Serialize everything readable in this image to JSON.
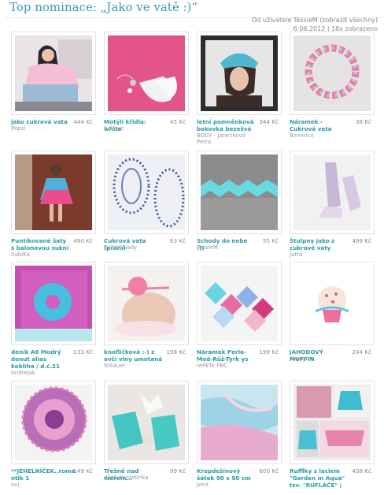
{
  "title": "Top nominace: „Jako ve vatě :)“",
  "meta": {
    "prefix": "Od uživatele",
    "user": "TessieM",
    "show_all": "(zobrazit všechny)",
    "date": "6.06.2012",
    "views": "18x zobrazeno"
  },
  "items": [
    {
      "name": "jako cukrová vata",
      "price": "444 Kč",
      "author": "Pepsi"
    },
    {
      "name": "Motýlí křídla: white",
      "price": "45 Kč",
      "author": "buttear"
    },
    {
      "name": "letní pomněnková bekovka bezešvá",
      "price": "344 Kč",
      "author": "BOGY - Janečková Petra"
    },
    {
      "name": "Náramek - Cukrová vata",
      "price": "38 Kč",
      "author": "Benerice"
    },
    {
      "name": "Puntíkované šaty s balonovou sukní",
      "price": "490 Kč",
      "author": "habiKa"
    },
    {
      "name": "Cukrová vata (přání)",
      "price": "63 Kč",
      "author": "Eye of Nady"
    },
    {
      "name": "Schody do nebe :))",
      "price": "55 Kč",
      "author": "TessieM"
    },
    {
      "name": "Štulpny jako z cukrové vaty",
      "price": "499 Kč",
      "author": "Jutta"
    },
    {
      "name": "deník A6 Modrý donut alias kobliha / d.č.21",
      "price": "133 Kč",
      "author": "Andrejak"
    },
    {
      "name": "knoflíčková :-) z ovčí vlny umotaná",
      "price": "198 Kč",
      "author": "toSauer"
    },
    {
      "name": "Náramek Perla-Mod-Růž-Tyrk ys",
      "price": "199 Kč",
      "author": "rePETe PBC"
    },
    {
      "name": "JAHODOVÝ MUFFIN",
      "price": "244 Kč",
      "author": "iloveyou"
    },
    {
      "name": "**JEHELNÍČEK..roma ntik 1",
      "price": "149 Kč",
      "author": "ovi"
    },
    {
      "name": "Třešně nad mořem...",
      "price": "99 Kč",
      "author": "dílna Kopretinka"
    },
    {
      "name": "Krepdešínový šátek 90 x 90 cm",
      "price": "600 Kč",
      "author": "jena"
    },
    {
      "name": "Rufflky s laclem \"Garden in Aqua\" tzv. \"RUFLÁČE\" ;",
      "price": "438 Kč",
      "author": ""
    }
  ],
  "icons": [
    "photo-thumbnail"
  ]
}
